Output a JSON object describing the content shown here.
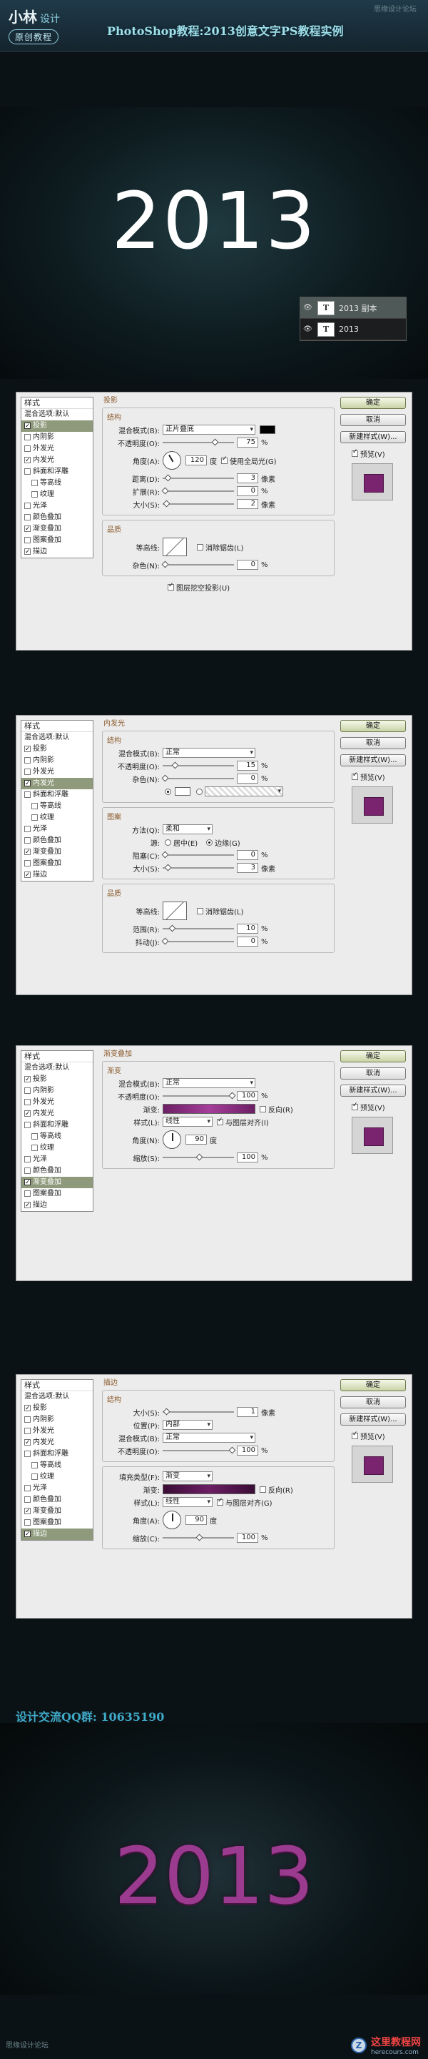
{
  "header": {
    "logo_main": "小林",
    "logo_sub": "设计",
    "logo_tag": "原创教程",
    "title": "PhotoShop教程:2013创意文字PS教程实例",
    "watermark": "思缘设计论坛"
  },
  "canvas1": {
    "text": "2013"
  },
  "layers": {
    "rows": [
      {
        "name": "2013 副本",
        "selected": true
      },
      {
        "name": "2013",
        "selected": false
      }
    ],
    "layer_type_glyph": "T",
    "eye_glyph": "👁"
  },
  "common": {
    "styles_header": "样式",
    "blend_default": "混合选项:默认",
    "styles": [
      {
        "label": "投影",
        "indent": false
      },
      {
        "label": "内阴影",
        "indent": false
      },
      {
        "label": "外发光",
        "indent": false
      },
      {
        "label": "内发光",
        "indent": false
      },
      {
        "label": "斜面和浮雕",
        "indent": false
      },
      {
        "label": "等高线",
        "indent": true
      },
      {
        "label": "纹理",
        "indent": true
      },
      {
        "label": "光泽",
        "indent": false
      },
      {
        "label": "颜色叠加",
        "indent": false
      },
      {
        "label": "渐变叠加",
        "indent": false
      },
      {
        "label": "图案叠加",
        "indent": false
      },
      {
        "label": "描边",
        "indent": false
      }
    ],
    "ok": "确定",
    "cancel": "取消",
    "new_style": "新建样式(W)...",
    "preview": "预览(V)",
    "structure": "结构",
    "quality": "品质",
    "blend_mode_label": "混合模式(B):",
    "opacity_label": "不透明度(O):",
    "percent": "%",
    "px": "像素",
    "degree": "度"
  },
  "dialog1": {
    "section": "投影",
    "checked": [
      true,
      false,
      false,
      true,
      false,
      false,
      false,
      false,
      false,
      true,
      false,
      true
    ],
    "selected_index": 0,
    "blend_mode": "正片叠底",
    "opacity": "75",
    "angle_label": "角度(A):",
    "angle": "120",
    "global_light": "使用全局光(G)",
    "distance_label": "距离(D):",
    "distance": "3",
    "spread_label": "扩展(R):",
    "spread": "0",
    "size_label": "大小(S):",
    "size": "2",
    "contour_label": "等高线:",
    "antialias": "消除锯齿(L)",
    "noise_label": "杂色(N):",
    "noise": "0",
    "knockout": "图层挖空投影(U)"
  },
  "dialog2": {
    "section": "内发光",
    "checked": [
      true,
      false,
      false,
      true,
      false,
      false,
      false,
      false,
      false,
      true,
      false,
      true
    ],
    "selected_index": 3,
    "blend_mode": "正常",
    "opacity": "15",
    "noise_label": "杂色(N):",
    "noise": "0",
    "elements": "图案",
    "method_label": "方法(Q):",
    "method": "柔和",
    "source_label": "源:",
    "center": "居中(E)",
    "edge": "边缘(G)",
    "choke_label": "阻塞(C):",
    "choke": "0",
    "size_label": "大小(S):",
    "size": "3",
    "contour_label": "等高线:",
    "antialias": "消除锯齿(L)",
    "range_label": "范围(R):",
    "range": "10",
    "jitter_label": "抖动(J):",
    "jitter": "0"
  },
  "dialog3": {
    "section": "渐变叠加",
    "sub": "渐变",
    "checked": [
      true,
      false,
      false,
      true,
      false,
      false,
      false,
      false,
      false,
      true,
      false,
      true
    ],
    "selected_index": 9,
    "blend_mode": "正常",
    "opacity": "100",
    "gradient_label": "渐变:",
    "reverse": "反向(R)",
    "style_label": "样式(L):",
    "style": "线性",
    "align": "与图层对齐(I)",
    "angle_label": "角度(N):",
    "angle": "90",
    "scale_label": "缩放(S):",
    "scale": "100"
  },
  "dialog4": {
    "section": "描边",
    "checked": [
      true,
      false,
      false,
      true,
      false,
      false,
      false,
      false,
      false,
      true,
      false,
      true
    ],
    "selected_index": 11,
    "size_label": "大小(S):",
    "size": "1",
    "position_label": "位置(P):",
    "position": "内部",
    "blend_mode": "正常",
    "opacity": "100",
    "fill_type_label": "填充类型(F):",
    "fill_type": "渐变",
    "gradient_label": "渐变:",
    "reverse": "反向(R)",
    "style_label": "样式(L):",
    "style": "线性",
    "align": "与图层对齐(G)",
    "angle_label": "角度(A):",
    "angle": "90",
    "scale_label": "缩放(C):",
    "scale": "100"
  },
  "footer": {
    "qq": "设计交流QQ群: 10635190",
    "year": "2013",
    "watermark": "思缘设计论坛",
    "site_name": "这里教程网",
    "site_url": "herecours.com",
    "site_glyph": "Z"
  }
}
